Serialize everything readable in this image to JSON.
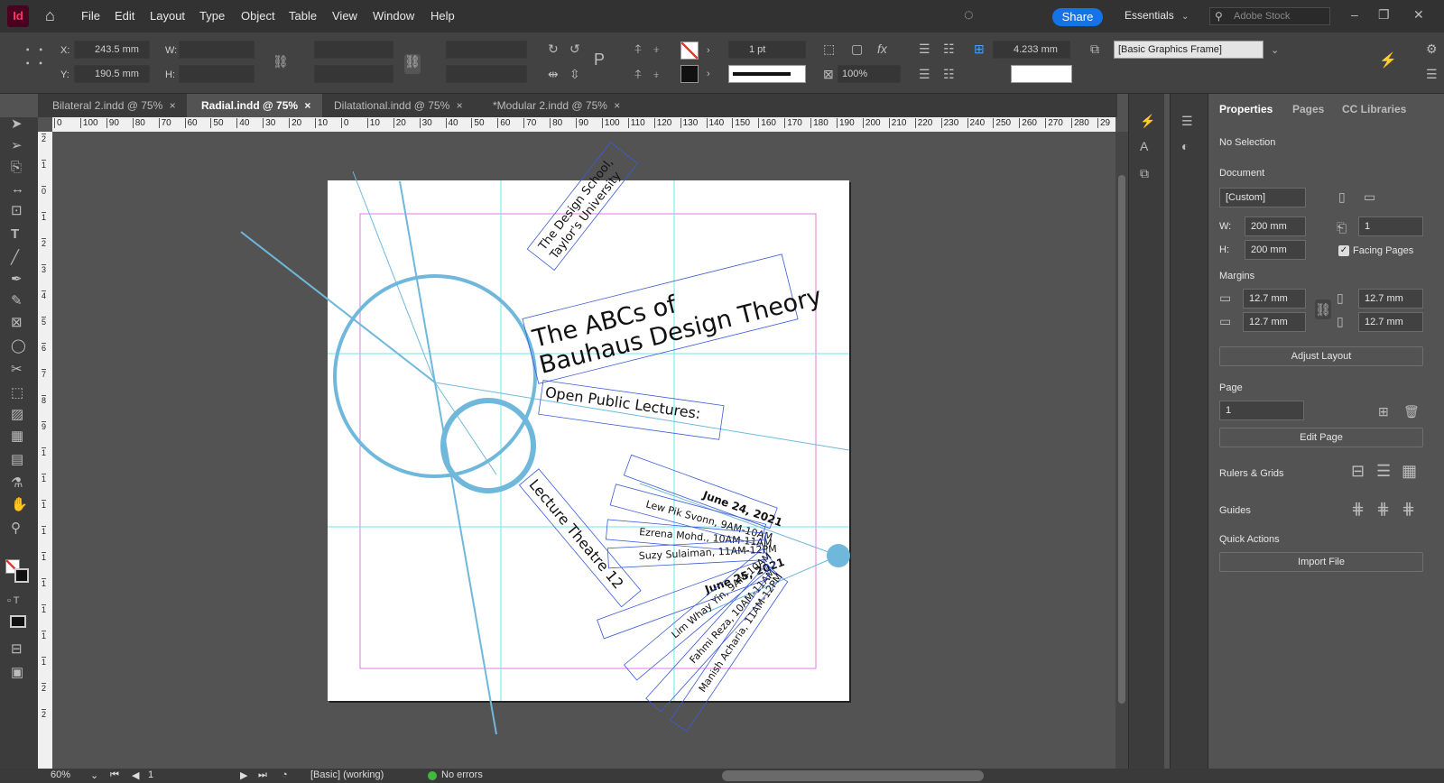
{
  "app": {
    "icon_text": "Id"
  },
  "menu": [
    "File",
    "Edit",
    "Layout",
    "Type",
    "Object",
    "Table",
    "View",
    "Window",
    "Help"
  ],
  "header": {
    "share": "Share",
    "workspace": "Essentials",
    "stock_placeholder": "Adobe Stock"
  },
  "control": {
    "x_label": "X:",
    "x_value": "243.5 mm",
    "y_label": "Y:",
    "y_value": "190.5 mm",
    "w_label": "W:",
    "h_label": "H:",
    "stroke_weight": "1 pt",
    "opacity": "100%",
    "gutter": "4.233 mm",
    "object_style": "[Basic Graphics Frame]"
  },
  "tabs": [
    {
      "label": "Bilateral 2.indd @ 75%",
      "close": "×"
    },
    {
      "label": "Radial.indd @ 75%",
      "close": "×"
    },
    {
      "label": "Dilatational.indd @ 75%",
      "close": "×"
    },
    {
      "label": "*Modular 2.indd @ 75%",
      "close": "×"
    }
  ],
  "ruler": {
    "h_ticks": [
      "0",
      "100",
      "90",
      "80",
      "70",
      "60",
      "50",
      "40",
      "30",
      "20",
      "10",
      "0",
      "10",
      "20",
      "30",
      "40",
      "50",
      "60",
      "70",
      "80",
      "90",
      "100",
      "110",
      "120",
      "130",
      "140",
      "150",
      "160",
      "170",
      "180",
      "190",
      "200",
      "210",
      "220",
      "230",
      "240",
      "250",
      "260",
      "270",
      "280",
      "29"
    ],
    "v_ticks": [
      "2",
      "1",
      "0",
      "1",
      "2",
      "3",
      "4",
      "5",
      "6",
      "7",
      "8",
      "9",
      "1",
      "1",
      "1",
      "1",
      "1",
      "1",
      "1",
      "1",
      "1",
      "2",
      "2"
    ]
  },
  "poster": {
    "school_1": "The Design School,",
    "school_2": "Taylor's University",
    "title_1": "The ABCs of",
    "title_2": "Bauhaus Design Theory",
    "subtitle": "Open Public Lectures:",
    "venue": "Lecture Theatre 12",
    "date_1": "June 24, 2021",
    "talk_1": "Lew Pik Svonn, 9AM-10AM",
    "talk_2": "Ezrena Mohd., 10AM-11AM",
    "talk_3": "Suzy Sulaiman, 11AM-12PM",
    "date_2": "June 25, 2021",
    "talk_4": "Lim Whay Yin, 9AM-10AM",
    "talk_5": "Fahmi Reza, 10AM-11AM",
    "talk_6": "Manish Acharia, 11AM-12PM"
  },
  "panel": {
    "tabs": [
      "Properties",
      "Pages",
      "CC Libraries"
    ],
    "selection": "No Selection",
    "document_label": "Document",
    "preset": "[Custom]",
    "w_label": "W:",
    "w_value": "200 mm",
    "h_label": "H:",
    "h_value": "200 mm",
    "pages_count": "1",
    "facing_pages": "Facing Pages",
    "margins_label": "Margins",
    "margin_top": "12.7 mm",
    "margin_bottom": "12.7 mm",
    "margin_inside": "12.7 mm",
    "margin_outside": "12.7 mm",
    "adjust_layout": "Adjust Layout",
    "page_label": "Page",
    "page_value": "1",
    "edit_page": "Edit Page",
    "rulers_grids": "Rulers & Grids",
    "guides": "Guides",
    "quick_actions": "Quick Actions",
    "import_file": "Import File"
  },
  "status": {
    "zoom": "60%",
    "page": "1",
    "profile": "[Basic] (working)",
    "preflight": "No errors"
  },
  "colors": {
    "accent": "#1473e6",
    "guide": "#6ee6ee",
    "margin": "#e07be0",
    "shape": "#6fb8dc",
    "preflight_ok": "#3dbb3d"
  }
}
